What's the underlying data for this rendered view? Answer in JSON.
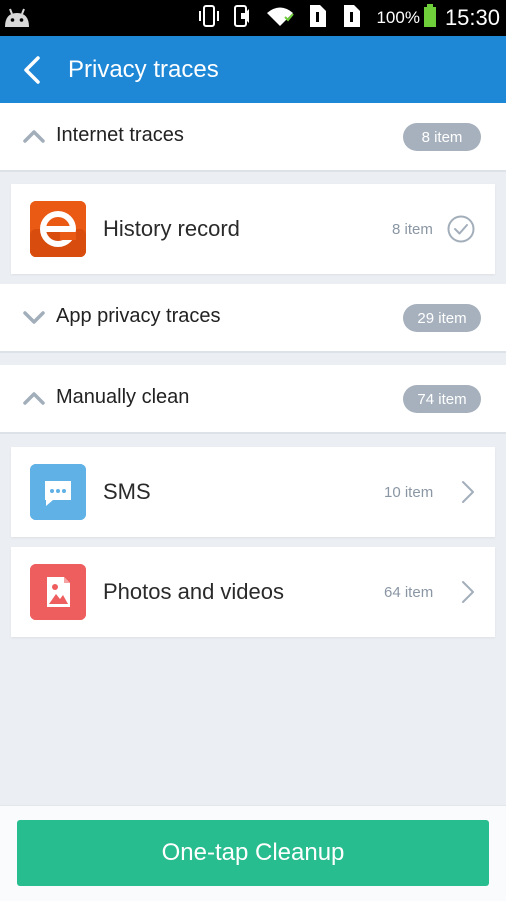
{
  "status_bar": {
    "battery_percent": "100%",
    "time": "15:30",
    "icons": [
      "android-icon",
      "vibrate-icon",
      "silent-icon",
      "wifi-icon",
      "sim1-icon",
      "sim2-icon",
      "battery-icon"
    ]
  },
  "app_bar": {
    "title": "Privacy traces",
    "back_icon": "back-arrow-icon"
  },
  "sections": [
    {
      "label": "Internet traces",
      "badge": "8 item",
      "expanded": true,
      "items": [
        {
          "label": "History record",
          "count": "8 item",
          "icon": "browser-e-icon",
          "action": "check-icon"
        }
      ]
    },
    {
      "label": "App privacy traces",
      "badge": "29 item",
      "expanded": false,
      "items": []
    },
    {
      "label": "Manually clean",
      "badge": "74 item",
      "expanded": true,
      "items": [
        {
          "label": "SMS",
          "count": "10 item",
          "icon": "sms-icon",
          "action": "chevron-right-icon"
        },
        {
          "label": "Photos and videos",
          "count": "64 item",
          "icon": "photos-icon",
          "action": "chevron-right-icon"
        }
      ]
    }
  ],
  "cta": {
    "label": "One-tap Cleanup"
  },
  "colors": {
    "app_bar": "#1e87d6",
    "cta": "#27bd8e",
    "badge": "#a6b1bd",
    "history_icon": "#ea5a14",
    "sms_icon": "#5fb1e6",
    "photos_icon": "#ef5e5e"
  }
}
